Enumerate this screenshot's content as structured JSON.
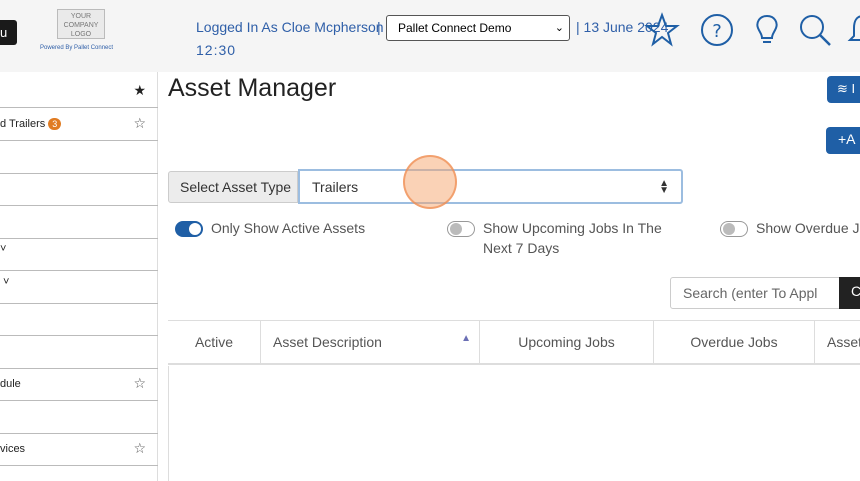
{
  "header": {
    "menu_label": "u",
    "logo_text": "YOUR COMPANY LOGO",
    "powered_by": "Powered By Pallet Connect",
    "logged_in": "Logged In As Cloe Mcpherson",
    "separator": "|",
    "system_select": "Pallet Connect Demo",
    "date": "| 13 June 2024",
    "time": "12:30",
    "icons": [
      "star-icon",
      "help-icon",
      "lightbulb-icon",
      "search-icon",
      "bell-icon"
    ]
  },
  "sidebar": {
    "items": [
      {
        "label": "",
        "star": "★"
      },
      {
        "label": "d Trailers",
        "badge": "3",
        "star": "☆"
      },
      {
        "label": "",
        "star": ""
      },
      {
        "label": "",
        "star": ""
      },
      {
        "label": "",
        "star": ""
      },
      {
        "label": "˅",
        "star": ""
      },
      {
        "label": "˅",
        "star": ""
      },
      {
        "label": "",
        "star": ""
      },
      {
        "label": "",
        "star": ""
      },
      {
        "label": "dule",
        "star": "☆"
      },
      {
        "label": "",
        "star": ""
      },
      {
        "label": "vices",
        "star": "☆"
      }
    ]
  },
  "main": {
    "title": "Asset Manager",
    "btn1_icon": "layers-icon",
    "btn1_label": "≋ I",
    "btn2_label": "+A",
    "asset_type_label": "Select Asset Type",
    "asset_type_value": "Trailers",
    "toggles": [
      {
        "label": "Only Show Active Assets",
        "on": true
      },
      {
        "label": "Show Upcoming Jobs In The Next 7 Days",
        "on": false
      },
      {
        "label": "Show Overdue Jo",
        "on": false
      }
    ],
    "search_placeholder": "Search (enter To Appl",
    "search_button": "C",
    "columns": [
      "Active",
      "Asset Description",
      "Upcoming Jobs",
      "Overdue Jobs",
      "Asset"
    ]
  },
  "colors": {
    "accent": "#1f5fa6",
    "link": "#2f5fa8",
    "badge": "#e07b22"
  }
}
